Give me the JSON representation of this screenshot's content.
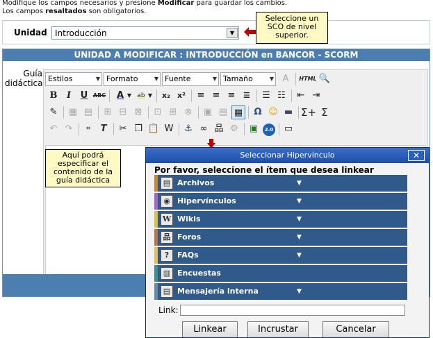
{
  "intro": {
    "line1_pre": "Modifique los campos necesarios y presione ",
    "line1_bold": "Modificar",
    "line1_post": " para guardar los cambios.",
    "line2_pre": "Los campos ",
    "line2_bold": "resaltados",
    "line2_post": " son obligatorios."
  },
  "unit": {
    "label": "Unidad",
    "value": "Introducción"
  },
  "tooltip_sco": "Seleccione un SCO de nivel superior.",
  "panel": {
    "title": "UNIDAD A MODIFICAR : INTRODUCCIÓN en BANCOR - SCORM"
  },
  "guia_label": "Guía didáctica:",
  "toolbar": {
    "styles": "Estilos",
    "format": "Formato",
    "font": "Fuente",
    "size": "Tamaño",
    "html_label": "HTML",
    "version_badge": "2.0"
  },
  "tooltip_content": "Aquí podrá especificar el contenido de la guía didáctica",
  "dialog": {
    "title": "Seleccionar Hipervínculo",
    "close": "✕",
    "prompt": "Por favor, seleccione el ítem que desea linkear",
    "items": [
      {
        "label": "Archivos",
        "icon": "file-icon",
        "arrow": "▼"
      },
      {
        "label": "Hipervínculos",
        "icon": "globe-icon",
        "arrow": "▼"
      },
      {
        "label": "Wikis",
        "icon": "wiki-icon",
        "arrow": "▼"
      },
      {
        "label": "Foros",
        "icon": "forum-icon",
        "arrow": "▼"
      },
      {
        "label": "FAQs",
        "icon": "faq-icon",
        "arrow": "▼"
      },
      {
        "label": "Encuestas",
        "icon": "survey-icon",
        "arrow": ""
      },
      {
        "label": "Mensajería interna",
        "icon": "message-icon",
        "arrow": "▼"
      }
    ],
    "link_label": "Link:",
    "link_value": "",
    "buttons": {
      "link": "Linkear",
      "embed": "Incrustar",
      "cancel": "Cancelar"
    }
  },
  "colors": {
    "header_blue": "#4c7fb0",
    "item_blue": "#2f5a8a",
    "tooltip_yellow": "#fff9c4",
    "arrow_red": "#c00000"
  }
}
